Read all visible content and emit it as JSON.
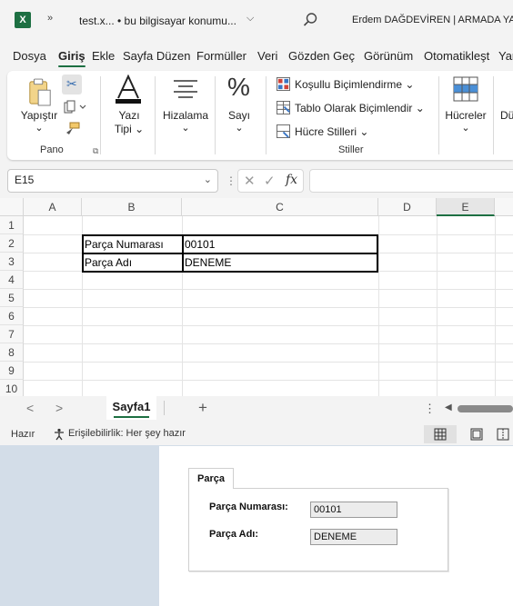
{
  "titlebar": {
    "app_icon": "X",
    "more_icon": "»",
    "file_name": "test.x...  •  bu bilgisayar konumu...",
    "chevron": "⌵",
    "user": "Erdem DAĞDEVİREN | ARMADA YAZ"
  },
  "tabs": [
    "Dosya",
    "Giriş",
    "Ekle",
    "Sayfa Düzen",
    "Formüller",
    "Veri",
    "Gözden Geç",
    "Görünüm",
    "Otomatikleşt",
    "Yar"
  ],
  "active_tab": "Giriş",
  "ribbon": {
    "paste_label": "Yapıştır",
    "paste_chev": "⌄",
    "font_label_1": "Yazı",
    "font_label_2": "Tipi ⌄",
    "align_label": "Hizalama",
    "align_chev": "⌄",
    "number_label": "Sayı",
    "number_chev": "⌄",
    "cond_format": "Koşullu Biçimlendirme ⌄",
    "format_table": "Tablo Olarak Biçimlendir ⌄",
    "cell_styles": "Hücre Stilleri ⌄",
    "cells_label": "Hücreler",
    "cells_chev": "⌄",
    "cut_icon_char": "✂",
    "overflow_label": "Dü",
    "group_clipboard": "Pano",
    "group_styles": "Stiller",
    "dialog_launcher": "⧉"
  },
  "formula_bar": {
    "name_box": "E15",
    "name_dd": "⌄",
    "dots": "⋮",
    "cancel": "✕",
    "enter": "✓",
    "fx": "fx"
  },
  "grid": {
    "columns": [
      "A",
      "B",
      "C",
      "D",
      "E"
    ],
    "selected_column": "E",
    "rows": [
      "1",
      "2",
      "3",
      "4",
      "5",
      "6",
      "7",
      "8",
      "9",
      "10"
    ],
    "cells": {
      "B2": "Parça Numarası",
      "C2": "00101",
      "B3": "Parça Adı",
      "C3": "DENEME"
    }
  },
  "sheets": {
    "prev": "<",
    "next": ">",
    "tabs": [
      "Sayfa1"
    ],
    "add": "+",
    "dots": "⋮",
    "scroll_left": "◀"
  },
  "status": {
    "ready": "Hazır",
    "accessibility": "Erişilebilirlik: Her şey hazır"
  },
  "dialog": {
    "tab_label": "Parça",
    "fields": [
      {
        "label": "Parça Numarası:",
        "value": "00101"
      },
      {
        "label": "Parça Adı:",
        "value": "DENEME"
      }
    ]
  },
  "colors": {
    "accent": "#1d6f42",
    "background_desktop": "#d3dde8",
    "window_chrome": "#f3f3f3"
  }
}
